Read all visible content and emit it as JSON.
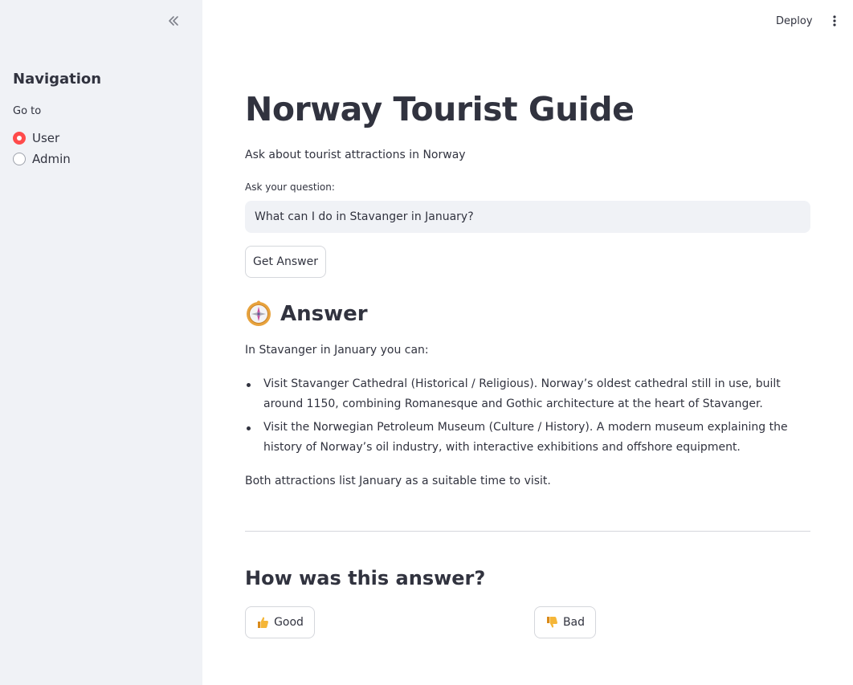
{
  "sidebar": {
    "collapse_icon": "double-chevron-left-icon",
    "title": "Navigation",
    "radio_label": "Go to",
    "options": [
      {
        "label": "User",
        "selected": true
      },
      {
        "label": "Admin",
        "selected": false
      }
    ]
  },
  "topbar": {
    "deploy_label": "Deploy",
    "menu_icon": "vertical-dots-icon"
  },
  "main": {
    "title": "Norway Tourist Guide",
    "subtitle": "Ask about tourist attractions in Norway",
    "input": {
      "label": "Ask your question:",
      "value": "What can I do in Stavanger in January?"
    },
    "submit_label": "Get Answer",
    "answer": {
      "icon": "compass-icon",
      "heading": "Answer",
      "intro": "In Stavanger in January you can:",
      "items": [
        "Visit Stavanger Cathedral (Historical / Religious). Norway’s oldest cathedral still in use, built around 1150, combining Romanesque and Gothic architecture at the heart of Stavanger.",
        "Visit the Norwegian Petroleum Museum (Culture / History). A modern museum explaining the history of Norway’s oil industry, with interactive exhibitions and offshore equipment."
      ],
      "outro": "Both attractions list January as a suitable time to visit."
    },
    "feedback": {
      "heading": "How was this answer?",
      "good_label": "Good",
      "good_icon": "thumbs-up-icon",
      "bad_label": "Bad",
      "bad_icon": "thumbs-down-icon"
    }
  },
  "colors": {
    "accent": "#ff4b4b",
    "sidebar_bg": "#f0f2f6",
    "text": "#31333f"
  }
}
